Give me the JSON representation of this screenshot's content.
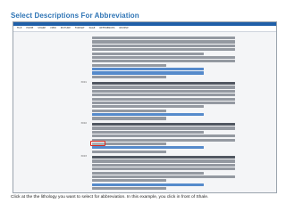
{
  "page_title": "Select Descriptions For Abbreviation",
  "app": {
    "menu_items": [
      "FILE",
      "HOME",
      "SHARE",
      "VIEW",
      "PICTURE",
      "FORMAT",
      "PAGE",
      "REFERENCES",
      "REVIEW"
    ]
  },
  "records": [
    {
      "id": ""
    },
    {
      "id": "3001"
    },
    {
      "id": "3002"
    },
    {
      "id": "3003"
    }
  ],
  "caption": "Click at the the lithology you want to select for abbreviation. In this example, you click in front of Shale.",
  "colors": {
    "title": "#2e74b5",
    "highlight": "#d9291c"
  }
}
